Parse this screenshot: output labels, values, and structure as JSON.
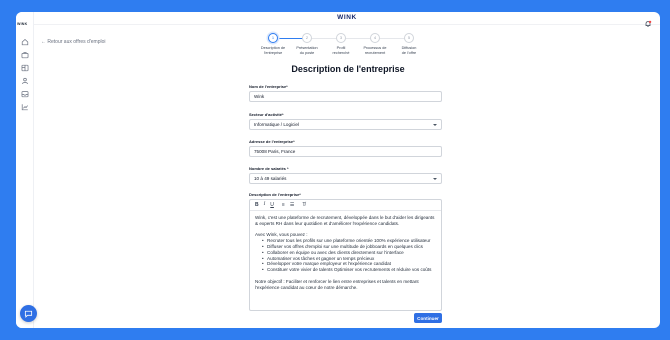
{
  "sidebar": {
    "logo": "WINK",
    "icons": [
      "home-icon",
      "briefcase-icon",
      "board-icon",
      "users-icon",
      "inbox-icon",
      "analytics-icon"
    ]
  },
  "header": {
    "brand": "WINK",
    "notification_icon": "bell-icon"
  },
  "back_link": {
    "label": "← Retour aux offres d'emploi"
  },
  "stepper": {
    "steps": [
      {
        "number": "1",
        "label_line1": "Description de",
        "label_line2": "l'entreprise",
        "active": true
      },
      {
        "number": "2",
        "label_line1": "Présentation",
        "label_line2": "du poste",
        "active": false
      },
      {
        "number": "3",
        "label_line1": "Profil",
        "label_line2": "recherché",
        "active": false
      },
      {
        "number": "4",
        "label_line1": "Processus de",
        "label_line2": "recrutement",
        "active": false
      },
      {
        "number": "5",
        "label_line1": "Diffusion",
        "label_line2": "de l'offre",
        "active": false
      }
    ]
  },
  "page_title": "Description de l'entreprise",
  "form": {
    "company_name": {
      "label": "Nom de l'entreprise*",
      "value": "Wink"
    },
    "sector": {
      "label": "Secteur d'activité*",
      "value": "Informatique / Logiciel"
    },
    "address": {
      "label": "Adresse de l'entreprise*",
      "value": "75008 Paris, France"
    },
    "employees": {
      "label": "Nombre de salariés *",
      "value": "10 à 49 salariés"
    },
    "description": {
      "label": "Description de l'entreprise*",
      "toolbar": {
        "bold": "B",
        "italic": "I",
        "underline": "U",
        "ordered_list": "≡",
        "bullet_list": "☰",
        "clear_format": "T̸"
      },
      "intro": "Wink, c'est une plateforme de recrutement, développée dans le but d'aider les dirigeants & experts RH dans leur quotidien et d'améliorer l'expérience candidats.",
      "list_intro": "Avec Wink, vous pouvez :",
      "bullets": [
        "Recruter tous les profils sur une plateforme orientée 100% expérience utilisateur",
        "Diffuser vos offres d'emploi sur une multitude de jobboards en quelques clics",
        "Collaborer en équipe ou avec des clients directement sur l'interface",
        "Automatiser vos tâches et gagner un temps précieux",
        "Développer votre marque employeur et l'expérience candidat",
        "Constituer votre vivier de talents Optimiser vos recrutements et réduire vos coûts"
      ],
      "objective": "Notre objectif : Faciliter et renforcer le lien entre entreprises et talents en mettant l'expérience candidat au cœur de notre démarche."
    }
  },
  "continue_button": "Continuer",
  "colors": {
    "background": "#2f7df0",
    "primary": "#2f6fe4",
    "brand_text": "#1a2b6d"
  }
}
